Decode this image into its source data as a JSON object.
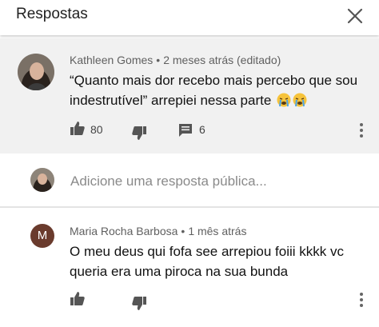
{
  "header": {
    "title": "Respostas"
  },
  "main_comment": {
    "author": "Kathleen Gomes",
    "time": "2 meses atrás (editado)",
    "text_line1": "“Quanto mais dor recebo mais percebo que sou",
    "text_line2": "indestrutível” arrepiei nessa parte",
    "emoji": "crying-face",
    "likes": "80",
    "replies": "6"
  },
  "reply_box": {
    "placeholder": "Adicione uma resposta pública..."
  },
  "reply": {
    "avatar_letter": "M",
    "avatar_color": "#6a3b2d",
    "author": "Maria Rocha Barbosa",
    "time": "1 mês atrás",
    "text_line1": "O meu deus qui fofa see arrepiou foiii kkkk vc",
    "text_line2": "queria era uma piroca na sua bunda"
  }
}
